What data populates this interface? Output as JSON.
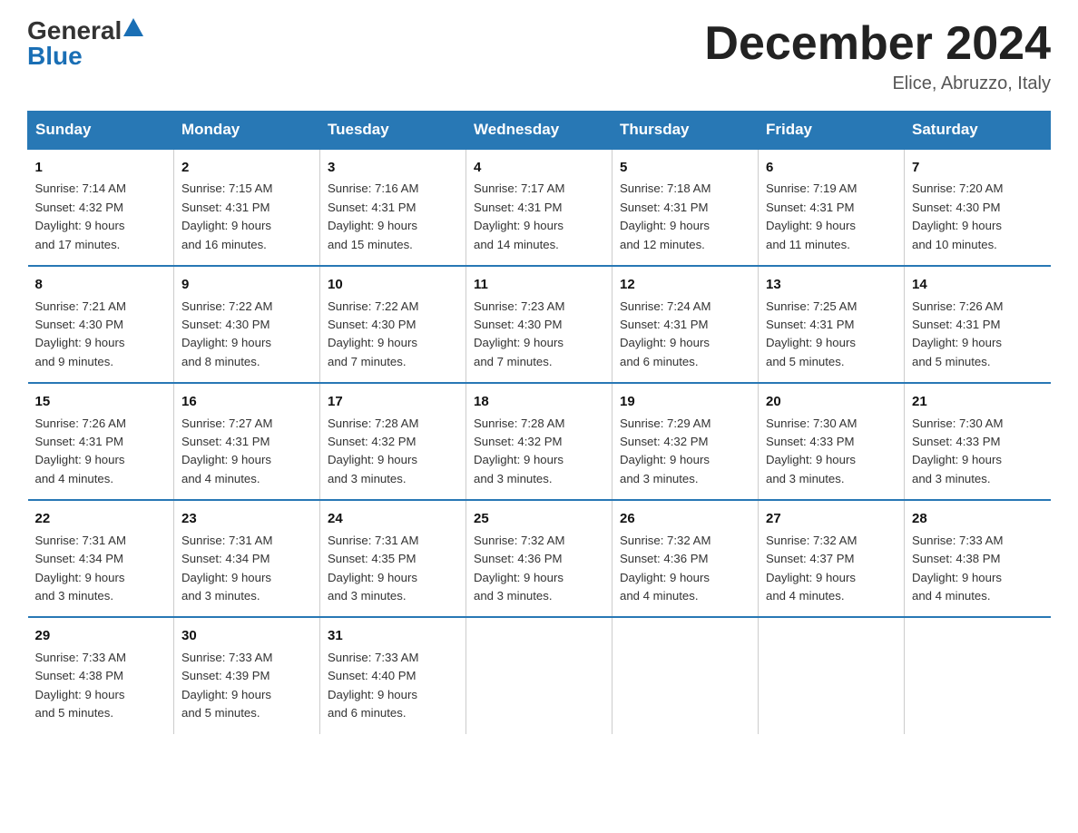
{
  "logo": {
    "general": "General",
    "blue": "Blue"
  },
  "title": "December 2024",
  "location": "Elice, Abruzzo, Italy",
  "weekdays": [
    "Sunday",
    "Monday",
    "Tuesday",
    "Wednesday",
    "Thursday",
    "Friday",
    "Saturday"
  ],
  "weeks": [
    [
      {
        "day": "1",
        "info": "Sunrise: 7:14 AM\nSunset: 4:32 PM\nDaylight: 9 hours\nand 17 minutes."
      },
      {
        "day": "2",
        "info": "Sunrise: 7:15 AM\nSunset: 4:31 PM\nDaylight: 9 hours\nand 16 minutes."
      },
      {
        "day": "3",
        "info": "Sunrise: 7:16 AM\nSunset: 4:31 PM\nDaylight: 9 hours\nand 15 minutes."
      },
      {
        "day": "4",
        "info": "Sunrise: 7:17 AM\nSunset: 4:31 PM\nDaylight: 9 hours\nand 14 minutes."
      },
      {
        "day": "5",
        "info": "Sunrise: 7:18 AM\nSunset: 4:31 PM\nDaylight: 9 hours\nand 12 minutes."
      },
      {
        "day": "6",
        "info": "Sunrise: 7:19 AM\nSunset: 4:31 PM\nDaylight: 9 hours\nand 11 minutes."
      },
      {
        "day": "7",
        "info": "Sunrise: 7:20 AM\nSunset: 4:30 PM\nDaylight: 9 hours\nand 10 minutes."
      }
    ],
    [
      {
        "day": "8",
        "info": "Sunrise: 7:21 AM\nSunset: 4:30 PM\nDaylight: 9 hours\nand 9 minutes."
      },
      {
        "day": "9",
        "info": "Sunrise: 7:22 AM\nSunset: 4:30 PM\nDaylight: 9 hours\nand 8 minutes."
      },
      {
        "day": "10",
        "info": "Sunrise: 7:22 AM\nSunset: 4:30 PM\nDaylight: 9 hours\nand 7 minutes."
      },
      {
        "day": "11",
        "info": "Sunrise: 7:23 AM\nSunset: 4:30 PM\nDaylight: 9 hours\nand 7 minutes."
      },
      {
        "day": "12",
        "info": "Sunrise: 7:24 AM\nSunset: 4:31 PM\nDaylight: 9 hours\nand 6 minutes."
      },
      {
        "day": "13",
        "info": "Sunrise: 7:25 AM\nSunset: 4:31 PM\nDaylight: 9 hours\nand 5 minutes."
      },
      {
        "day": "14",
        "info": "Sunrise: 7:26 AM\nSunset: 4:31 PM\nDaylight: 9 hours\nand 5 minutes."
      }
    ],
    [
      {
        "day": "15",
        "info": "Sunrise: 7:26 AM\nSunset: 4:31 PM\nDaylight: 9 hours\nand 4 minutes."
      },
      {
        "day": "16",
        "info": "Sunrise: 7:27 AM\nSunset: 4:31 PM\nDaylight: 9 hours\nand 4 minutes."
      },
      {
        "day": "17",
        "info": "Sunrise: 7:28 AM\nSunset: 4:32 PM\nDaylight: 9 hours\nand 3 minutes."
      },
      {
        "day": "18",
        "info": "Sunrise: 7:28 AM\nSunset: 4:32 PM\nDaylight: 9 hours\nand 3 minutes."
      },
      {
        "day": "19",
        "info": "Sunrise: 7:29 AM\nSunset: 4:32 PM\nDaylight: 9 hours\nand 3 minutes."
      },
      {
        "day": "20",
        "info": "Sunrise: 7:30 AM\nSunset: 4:33 PM\nDaylight: 9 hours\nand 3 minutes."
      },
      {
        "day": "21",
        "info": "Sunrise: 7:30 AM\nSunset: 4:33 PM\nDaylight: 9 hours\nand 3 minutes."
      }
    ],
    [
      {
        "day": "22",
        "info": "Sunrise: 7:31 AM\nSunset: 4:34 PM\nDaylight: 9 hours\nand 3 minutes."
      },
      {
        "day": "23",
        "info": "Sunrise: 7:31 AM\nSunset: 4:34 PM\nDaylight: 9 hours\nand 3 minutes."
      },
      {
        "day": "24",
        "info": "Sunrise: 7:31 AM\nSunset: 4:35 PM\nDaylight: 9 hours\nand 3 minutes."
      },
      {
        "day": "25",
        "info": "Sunrise: 7:32 AM\nSunset: 4:36 PM\nDaylight: 9 hours\nand 3 minutes."
      },
      {
        "day": "26",
        "info": "Sunrise: 7:32 AM\nSunset: 4:36 PM\nDaylight: 9 hours\nand 4 minutes."
      },
      {
        "day": "27",
        "info": "Sunrise: 7:32 AM\nSunset: 4:37 PM\nDaylight: 9 hours\nand 4 minutes."
      },
      {
        "day": "28",
        "info": "Sunrise: 7:33 AM\nSunset: 4:38 PM\nDaylight: 9 hours\nand 4 minutes."
      }
    ],
    [
      {
        "day": "29",
        "info": "Sunrise: 7:33 AM\nSunset: 4:38 PM\nDaylight: 9 hours\nand 5 minutes."
      },
      {
        "day": "30",
        "info": "Sunrise: 7:33 AM\nSunset: 4:39 PM\nDaylight: 9 hours\nand 5 minutes."
      },
      {
        "day": "31",
        "info": "Sunrise: 7:33 AM\nSunset: 4:40 PM\nDaylight: 9 hours\nand 6 minutes."
      },
      null,
      null,
      null,
      null
    ]
  ]
}
